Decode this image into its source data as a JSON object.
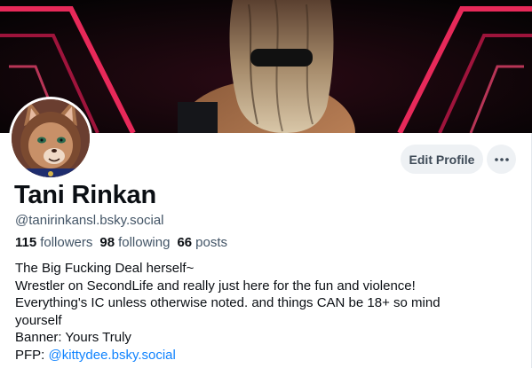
{
  "profile": {
    "display_name": "Tani Rinkan",
    "handle": "@tanirinkansl.bsky.social",
    "stats": {
      "followers_count": "115",
      "followers_label": "followers",
      "following_count": "98",
      "following_label": "following",
      "posts_count": "66",
      "posts_label": "posts"
    },
    "bio": {
      "line1": "The Big Fucking Deal herself~",
      "line2": "Wrestler on SecondLife and really just here for the fun and violence!",
      "line3": "Everything's IC unless otherwise noted. and things CAN be 18+ so mind",
      "line4": "yourself",
      "line5": "Banner: Yours Truly",
      "pfp_prefix": "PFP: ",
      "pfp_link": "@kittydee.bsky.social"
    }
  },
  "actions": {
    "edit_profile_label": "Edit Profile",
    "more_icon": "ellipsis-icon"
  },
  "colors": {
    "link": "#1083fe",
    "secondary_text": "#425466",
    "button_bg": "#eef1f4",
    "banner_neon": "#ff2e63"
  }
}
